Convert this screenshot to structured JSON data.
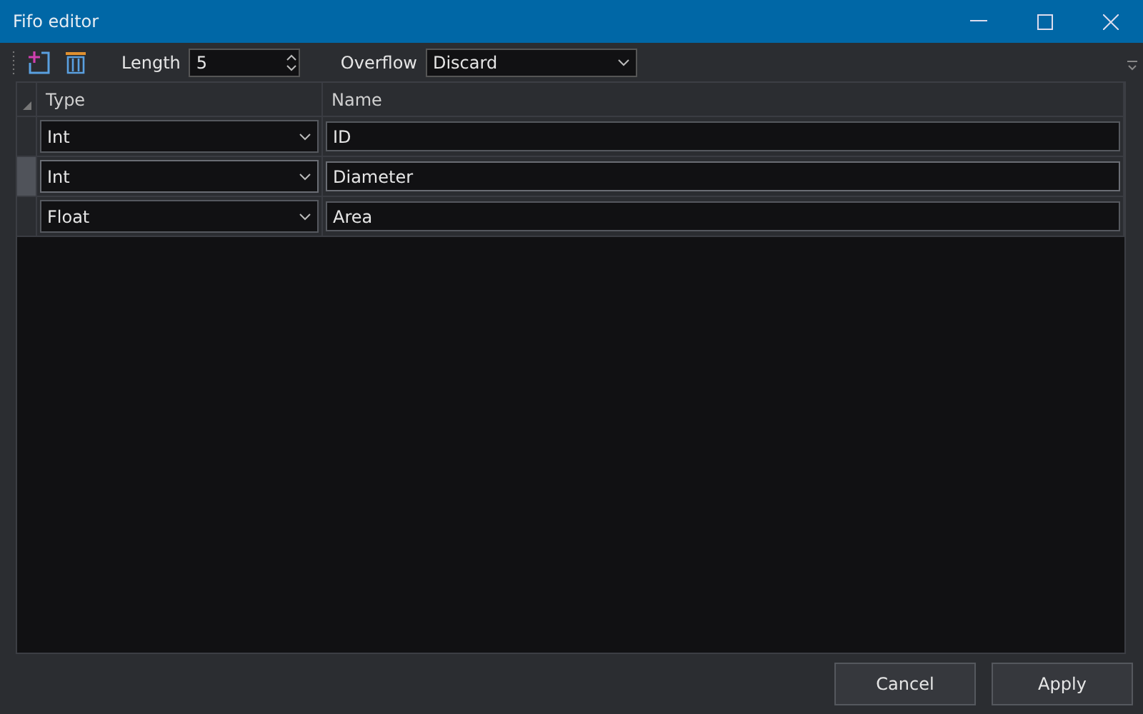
{
  "window": {
    "title": "Fifo editor"
  },
  "toolbar": {
    "length_label": "Length",
    "length_value": "5",
    "overflow_label": "Overflow",
    "overflow_value": "Discard"
  },
  "table": {
    "columns": [
      "Type",
      "Name"
    ],
    "rows": [
      {
        "type": "Int",
        "name": "ID",
        "selected": false
      },
      {
        "type": "Int",
        "name": "Diameter",
        "selected": true
      },
      {
        "type": "Float",
        "name": "Area",
        "selected": false
      }
    ]
  },
  "buttons": [
    "Cancel",
    "Apply"
  ]
}
